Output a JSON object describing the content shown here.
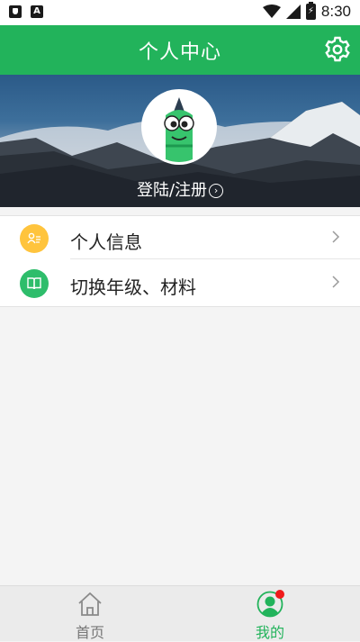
{
  "status_bar": {
    "time": "8:30",
    "battery_glyph": "⚡",
    "icons": [
      "shield-icon",
      "a-app-icon",
      "wifi-icon",
      "signal-icon",
      "battery-icon"
    ]
  },
  "header": {
    "title": "个人中心",
    "settings_icon": "gear-icon"
  },
  "profile": {
    "login_text": "登陆/注册",
    "login_chevron": "›",
    "avatar_icon": "pencil-mascot-icon"
  },
  "menu": {
    "items": [
      {
        "label": "个人信息",
        "icon": "person-info-icon",
        "icon_color": "#ffc43d"
      },
      {
        "label": "切换年级、材料",
        "icon": "book-icon",
        "icon_color": "#2ebd6b"
      }
    ]
  },
  "bottom_nav": {
    "items": [
      {
        "label": "首页",
        "icon": "home-icon",
        "active": false
      },
      {
        "label": "我的",
        "icon": "user-icon",
        "active": true,
        "badge": true
      }
    ]
  },
  "colors": {
    "accent": "#22b35b",
    "background": "#f4f4f4",
    "badge": "#f01b1b"
  }
}
